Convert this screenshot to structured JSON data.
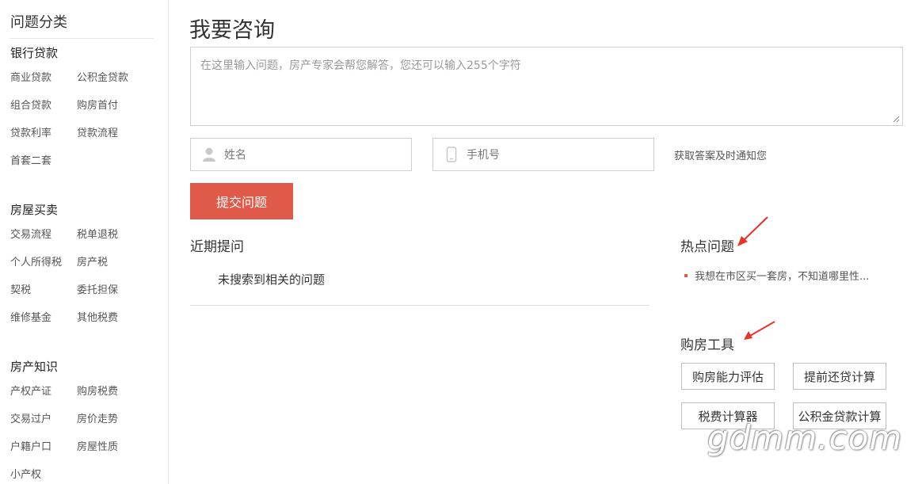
{
  "sidebar": {
    "title": "问题分类",
    "groups": [
      {
        "title": "银行贷款",
        "items": [
          "商业贷款",
          "公积金贷款",
          "组合贷款",
          "购房首付",
          "贷款利率",
          "贷款流程",
          "首套二套"
        ]
      },
      {
        "title": "房屋买卖",
        "items": [
          "交易流程",
          "税单退税",
          "个人所得税",
          "房产税",
          "契税",
          "委托担保",
          "维修基金",
          "其他税费"
        ]
      },
      {
        "title": "房产知识",
        "items": [
          "产权产证",
          "购房税费",
          "交易过户",
          "房价走势",
          "户籍户口",
          "房屋性质",
          "小产权"
        ]
      }
    ]
  },
  "main": {
    "title": "我要咨询",
    "question_placeholder": "在这里输入问题，房产专家会帮您解答，您还可以输入255个字符",
    "name_placeholder": "姓名",
    "phone_placeholder": "手机号",
    "notify_text": "获取答案及时通知您",
    "submit_label": "提交问题",
    "recent": {
      "title": "近期提问",
      "empty_text": "未搜索到相关的问题"
    }
  },
  "right": {
    "hot": {
      "title": "热点问题",
      "items": [
        "我想在市区买一套房，不知道哪里性..."
      ]
    },
    "tools": {
      "title": "购房工具",
      "buttons": [
        "购房能力评估",
        "提前还贷计算",
        "税费计算器",
        "公积金贷款计算"
      ]
    }
  },
  "watermark": "gdmm.com",
  "colors": {
    "accent": "#e05a4a",
    "annotation_arrow": "#e8322b"
  }
}
